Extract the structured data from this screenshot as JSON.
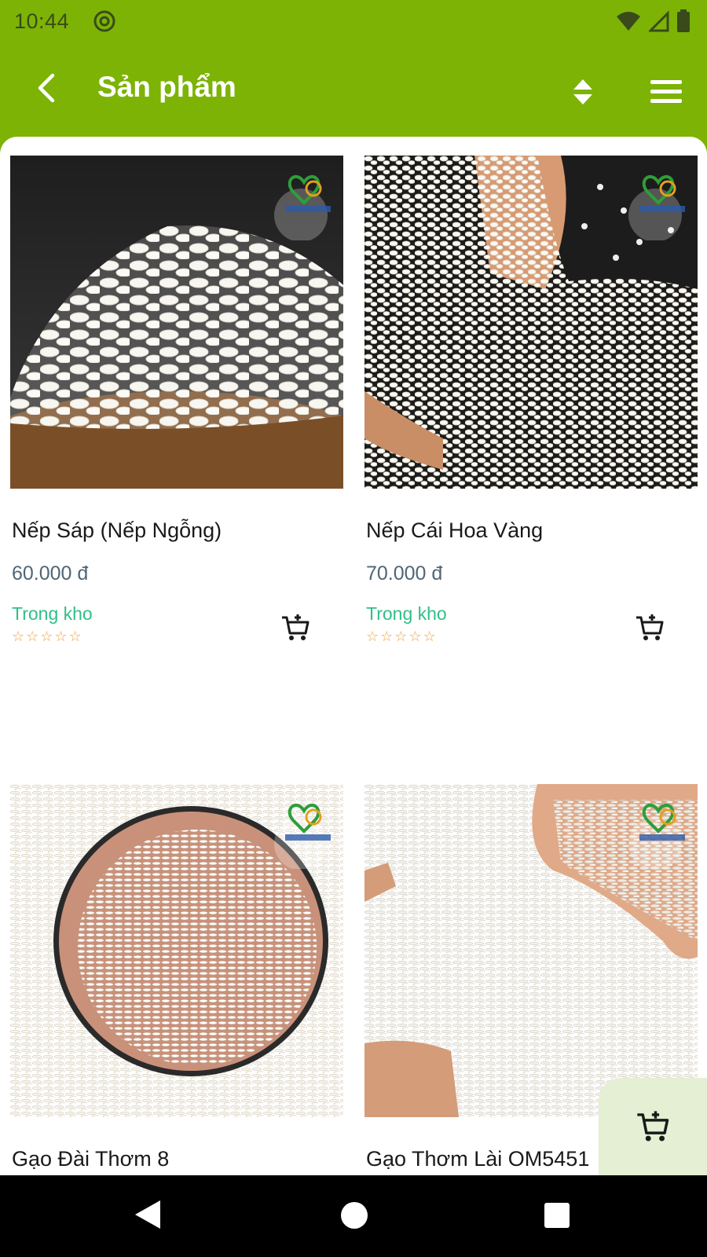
{
  "status_bar": {
    "time": "10:44"
  },
  "app_bar": {
    "title": "Sản phẩm"
  },
  "products": [
    {
      "name": "Nếp Sáp (Nếp Ngỗng)",
      "price": "60.000 đ",
      "stock": "Trong kho",
      "rating_display": "☆☆☆☆☆",
      "rating_value": 0
    },
    {
      "name": "Nếp Cái Hoa Vàng",
      "price": "70.000 đ",
      "stock": "Trong kho",
      "rating_display": "☆☆☆☆☆",
      "rating_value": 0
    },
    {
      "name": "Gạo Đài Thơm 8"
    },
    {
      "name": "Gạo Thơm Lài OM5451"
    }
  ],
  "colors": {
    "brand_green": "#7cb305",
    "stock_green": "#2fbf8a",
    "price": "#4f6675",
    "star": "#f0a23a",
    "fab_bg": "#e4efd3"
  },
  "icons": [
    "back-arrow-icon",
    "sort-icon",
    "hamburger-menu-icon",
    "add-to-cart-icon",
    "logo-badge"
  ]
}
